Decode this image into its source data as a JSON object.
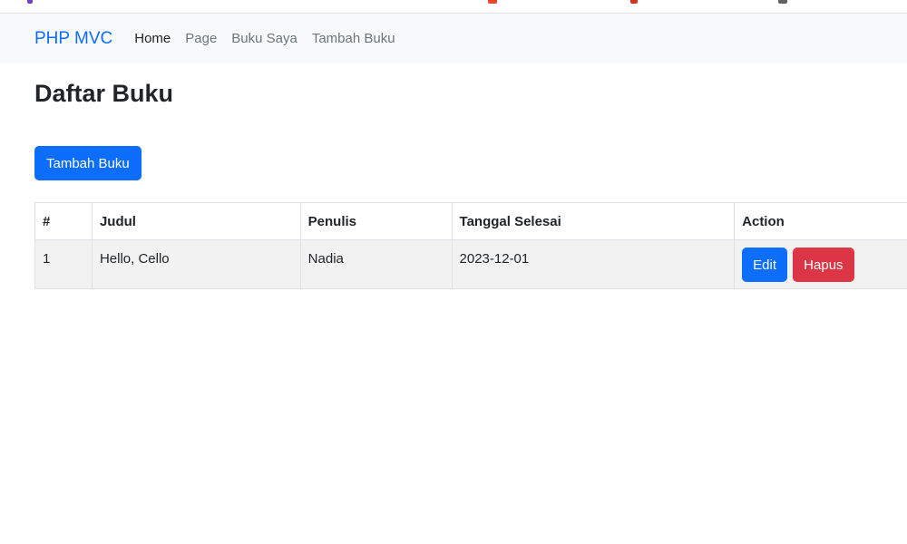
{
  "navbar": {
    "brand": "PHP MVC",
    "links": [
      {
        "label": "Home",
        "active": true
      },
      {
        "label": "Page",
        "active": false
      },
      {
        "label": "Buku Saya",
        "active": false
      },
      {
        "label": "Tambah Buku",
        "active": false
      }
    ]
  },
  "main": {
    "title": "Daftar Buku",
    "add_button": "Tambah Buku",
    "table": {
      "headers": [
        "#",
        "Judul",
        "Penulis",
        "Tanggal Selesai",
        "Action"
      ],
      "rows": [
        {
          "no": "1",
          "judul": "Hello, Cello",
          "penulis": "Nadia",
          "tanggal": "2023-12-01",
          "edit_label": "Edit",
          "delete_label": "Hapus"
        }
      ]
    }
  },
  "colors": {
    "primary": "#0d6efd",
    "danger": "#dc3545",
    "navbar_bg": "#f8f9fa",
    "row_bg": "#f2f2f2"
  }
}
